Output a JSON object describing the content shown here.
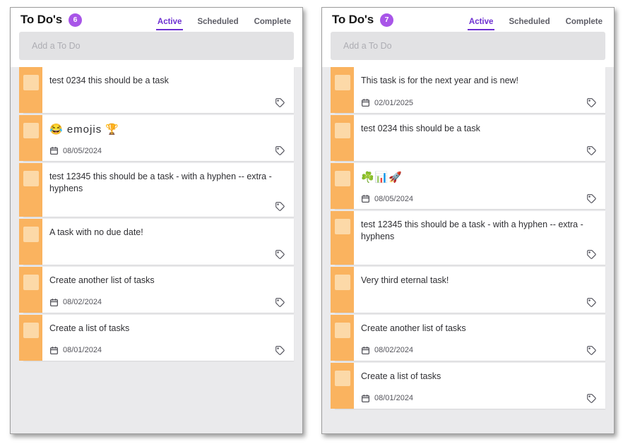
{
  "panels": [
    {
      "id": "left",
      "title": "To Do's",
      "count": "6",
      "tabs": [
        {
          "label": "Active",
          "active": true
        },
        {
          "label": "Scheduled",
          "active": false
        },
        {
          "label": "Complete",
          "active": false
        }
      ],
      "add_placeholder": "Add a To Do",
      "add_value": "",
      "tasks": [
        {
          "text": "test 0234 this should be a task",
          "due": "",
          "is_emoji": false
        },
        {
          "text": "😂 emojis 🏆",
          "due": "08/05/2024",
          "is_emoji": true
        },
        {
          "text": "test 12345 this should be a task - with a hyphen -- extra - hyphens",
          "due": "",
          "is_emoji": false
        },
        {
          "text": "A task with no due date!",
          "due": "",
          "is_emoji": false
        },
        {
          "text": "Create another list of tasks",
          "due": "08/02/2024",
          "is_emoji": false
        },
        {
          "text": "Create a list of tasks",
          "due": "08/01/2024",
          "is_emoji": false
        }
      ]
    },
    {
      "id": "right",
      "title": "To Do's",
      "count": "7",
      "tabs": [
        {
          "label": "Active",
          "active": true
        },
        {
          "label": "Scheduled",
          "active": false
        },
        {
          "label": "Complete",
          "active": false
        }
      ],
      "add_placeholder": "Add a To Do",
      "add_value": "",
      "tasks": [
        {
          "text": "This task is for the next year and is new!",
          "due": "02/01/2025",
          "is_emoji": false
        },
        {
          "text": "test 0234 this should be a task",
          "due": "",
          "is_emoji": false
        },
        {
          "text": "☘️📊🚀",
          "due": "08/05/2024",
          "is_emoji": true
        },
        {
          "text": "test 12345 this should be a task - with a hyphen -- extra - hyphens",
          "due": "",
          "is_emoji": false
        },
        {
          "text": "Very third eternal task!",
          "due": "",
          "is_emoji": false
        },
        {
          "text": "Create another list of tasks",
          "due": "08/02/2024",
          "is_emoji": false
        },
        {
          "text": "Create a list of tasks",
          "due": "08/01/2024",
          "is_emoji": false
        }
      ]
    }
  ],
  "colors": {
    "accent_purple": "#6d2fd1",
    "badge_purple": "#a855e8",
    "task_orange": "#fab35f",
    "checkbox_orange": "#fcd9a8",
    "list_bg": "#eaeaec",
    "input_bg": "#e2e2e4"
  },
  "icons": {
    "calendar": "calendar-icon",
    "tag": "tag-icon"
  }
}
